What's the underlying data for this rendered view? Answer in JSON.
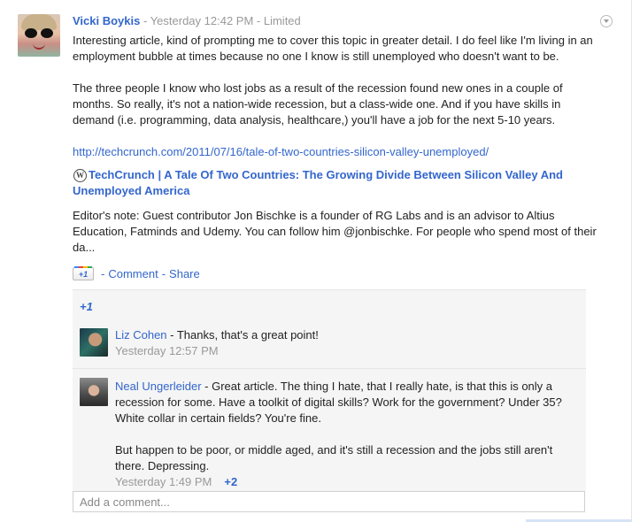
{
  "post": {
    "author": "Vicki Boykis",
    "timestamp": "Yesterday 12:42 PM",
    "visibility": "Limited",
    "separator": " - ",
    "paragraphs": [
      "Interesting article, kind of prompting me to cover this topic in greater detail. I do feel like I'm living in an employment bubble at times because no one I know is still unemployed who doesn't want to be.",
      "The three people I know who lost jobs as a result of the recession found new ones in a couple of months. So really, it's not a nation-wide recession, but a class-wide one. And if you have skills in demand (i.e. programming, data analysis, healthcare,) you'll have a job for the next 5-10 years."
    ],
    "url": "http://techcrunch.com/2011/07/16/tale-of-two-countries-silicon-valley-unemployed/",
    "article_title": "TechCrunch | A Tale Of Two Countries: The Growing Divide Between Silicon Valley And Unemployed America",
    "article_description": "Editor's note: Guest contributor Jon Bischke is a founder of RG Labs and is an advisor to Altius Education, Fatminds and Udemy. You can follow him @jonbischke. For people who spend most of their da..."
  },
  "actions": {
    "plusone_label": "+1",
    "comment_label": "Comment",
    "share_label": "Share",
    "separator": "-"
  },
  "plus_count": "+1",
  "comments": [
    {
      "author": "Liz Cohen",
      "text": " - Thanks, that's a great point!",
      "time": "Yesterday 12:57 PM"
    },
    {
      "author": "Neal Ungerleider",
      "text_1": " - Great article. The thing I hate, that I really hate, is that this is only a recession for some. Have a toolkit of digital skills? Work for the government? Under 35? White collar in certain fields? You're fine.",
      "text_2": "But happen to be poor, or middle aged, and it's still a recession and the jobs still aren't there. Depressing.",
      "time": "Yesterday 1:49 PM",
      "plus": "+2"
    }
  ],
  "comment_input": {
    "placeholder": "Add a comment..."
  },
  "icons": {
    "menu": "chevron-down-circle-icon",
    "source": "wordpress-icon",
    "plusone": "google-plusone-icon"
  },
  "colors": {
    "link": "#3366cc",
    "meta": "#999999",
    "comment_bg": "#f5f5f5"
  }
}
